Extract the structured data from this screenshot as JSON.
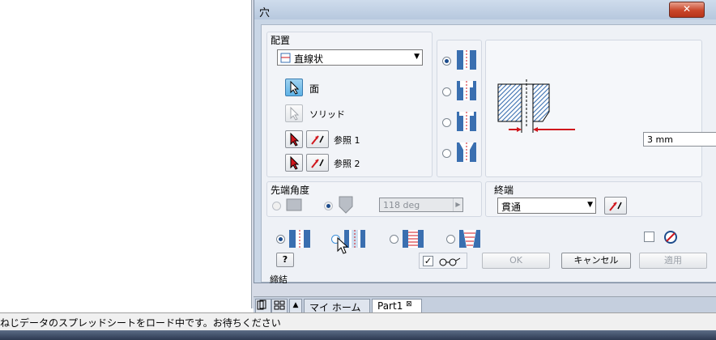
{
  "dialog": {
    "title": "穴",
    "close": "✕",
    "placement": {
      "group_label": "配置",
      "type_value": "直線状",
      "face_label": "面",
      "solid_label": "ソリッド",
      "ref1_label": "参照 1",
      "ref2_label": "参照 2"
    },
    "distance_value": "3 mm",
    "drill_point": {
      "group_label": "先端角度",
      "angle_value": "118 deg"
    },
    "termination": {
      "group_label": "終端",
      "value": "貫通"
    },
    "buttons": {
      "help": "?",
      "ok": "OK",
      "cancel": "キャンセル",
      "apply": "適用"
    },
    "cut_label": "締結"
  },
  "tabs": {
    "home": "マイ ホーム",
    "part": "Part1",
    "part_close": "⊠"
  },
  "status": {
    "message": "ねじデータのスプレッドシートをロード中です。お待ちください"
  },
  "colors": {
    "accent_red": "#d0161c",
    "hatch_blue": "#3a6fb0",
    "dialog_bg": "#eef1f6"
  }
}
